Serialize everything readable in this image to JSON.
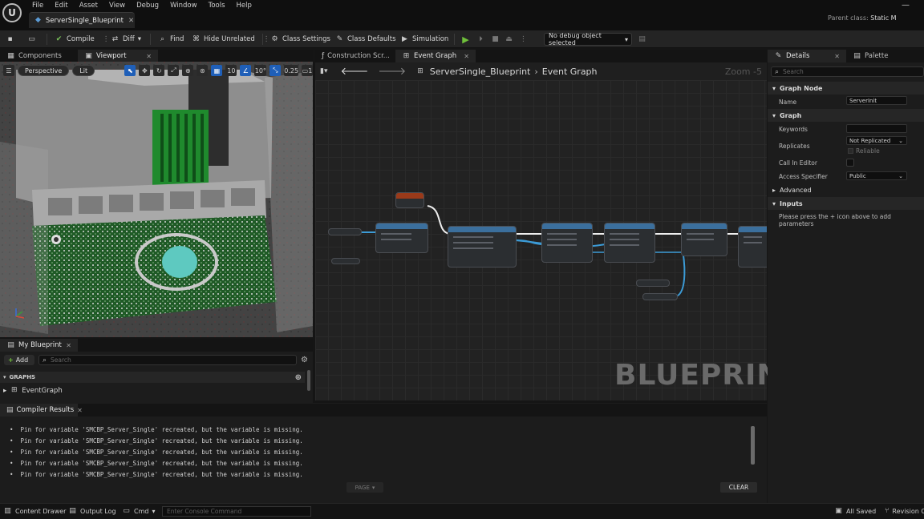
{
  "menu": [
    "File",
    "Edit",
    "Asset",
    "View",
    "Debug",
    "Window",
    "Tools",
    "Help"
  ],
  "document_tab": {
    "label": "ServerSingle_Blueprint"
  },
  "parent_class": {
    "label": "Parent class:",
    "value": "Static M"
  },
  "toolbar": {
    "compile": "Compile",
    "diff": "Diff",
    "find": "Find",
    "hide_unrelated": "Hide Unrelated",
    "class_settings": "Class Settings",
    "class_defaults": "Class Defaults",
    "simulation": "Simulation",
    "debug_object": "No debug object selected"
  },
  "left_tabs": {
    "components": "Components",
    "viewport": "Viewport"
  },
  "viewport_bar": {
    "perspective": "Perspective",
    "lit": "Lit",
    "grid": "10",
    "angle": "10°",
    "scale": "0.25",
    "camera": "1"
  },
  "graph_tabs": {
    "construction": "Construction Scr...",
    "event_graph": "Event Graph"
  },
  "graph_breadcrumb": {
    "blueprint": "ServerSingle_Blueprint",
    "graph": "Event Graph",
    "zoom": "Zoom -5"
  },
  "graph_watermark": "BLUEPRINT",
  "details_tabs": {
    "details": "Details",
    "palette": "Palette"
  },
  "details": {
    "search_placeholder": "Search",
    "graph_node_section": "Graph Node",
    "name_label": "Name",
    "name_value": "ServerInit",
    "graph_section": "Graph",
    "keywords_label": "Keywords",
    "replicates_label": "Replicates",
    "replicates_value": "Not Replicated",
    "reliable_label": "Reliable",
    "call_in_editor_label": "Call In Editor",
    "access_label": "Access Specifier",
    "access_value": "Public",
    "advanced_section": "Advanced",
    "inputs_section": "Inputs",
    "inputs_hint": "Please press the + icon above to add parameters"
  },
  "my_blueprint": {
    "tab": "My Blueprint",
    "add": "Add",
    "search_placeholder": "Search",
    "graphs_header": "GRAPHS",
    "event_graph": "EventGraph"
  },
  "compiler": {
    "tab": "Compiler Results",
    "lines": [
      "Pin for variable 'SMCBP_Server_Single' recreated, but the variable is missing.",
      "Pin for variable 'SMCBP_Server_Single' recreated, but the variable is missing.",
      "Pin for variable 'SMCBP_Server_Single' recreated, but the variable is missing.",
      "Pin for variable 'SMCBP_Server_Single' recreated, but the variable is missing.",
      "Pin for variable 'SMCBP_Server_Single' recreated, but the variable is missing."
    ],
    "page": "PAGE",
    "clear": "CLEAR"
  },
  "statusbar": {
    "content_drawer": "Content Drawer",
    "output_log": "Output Log",
    "cmd": "Cmd",
    "console_placeholder": "Enter Console Command",
    "all_saved": "All Saved",
    "revision": "Revision C"
  }
}
